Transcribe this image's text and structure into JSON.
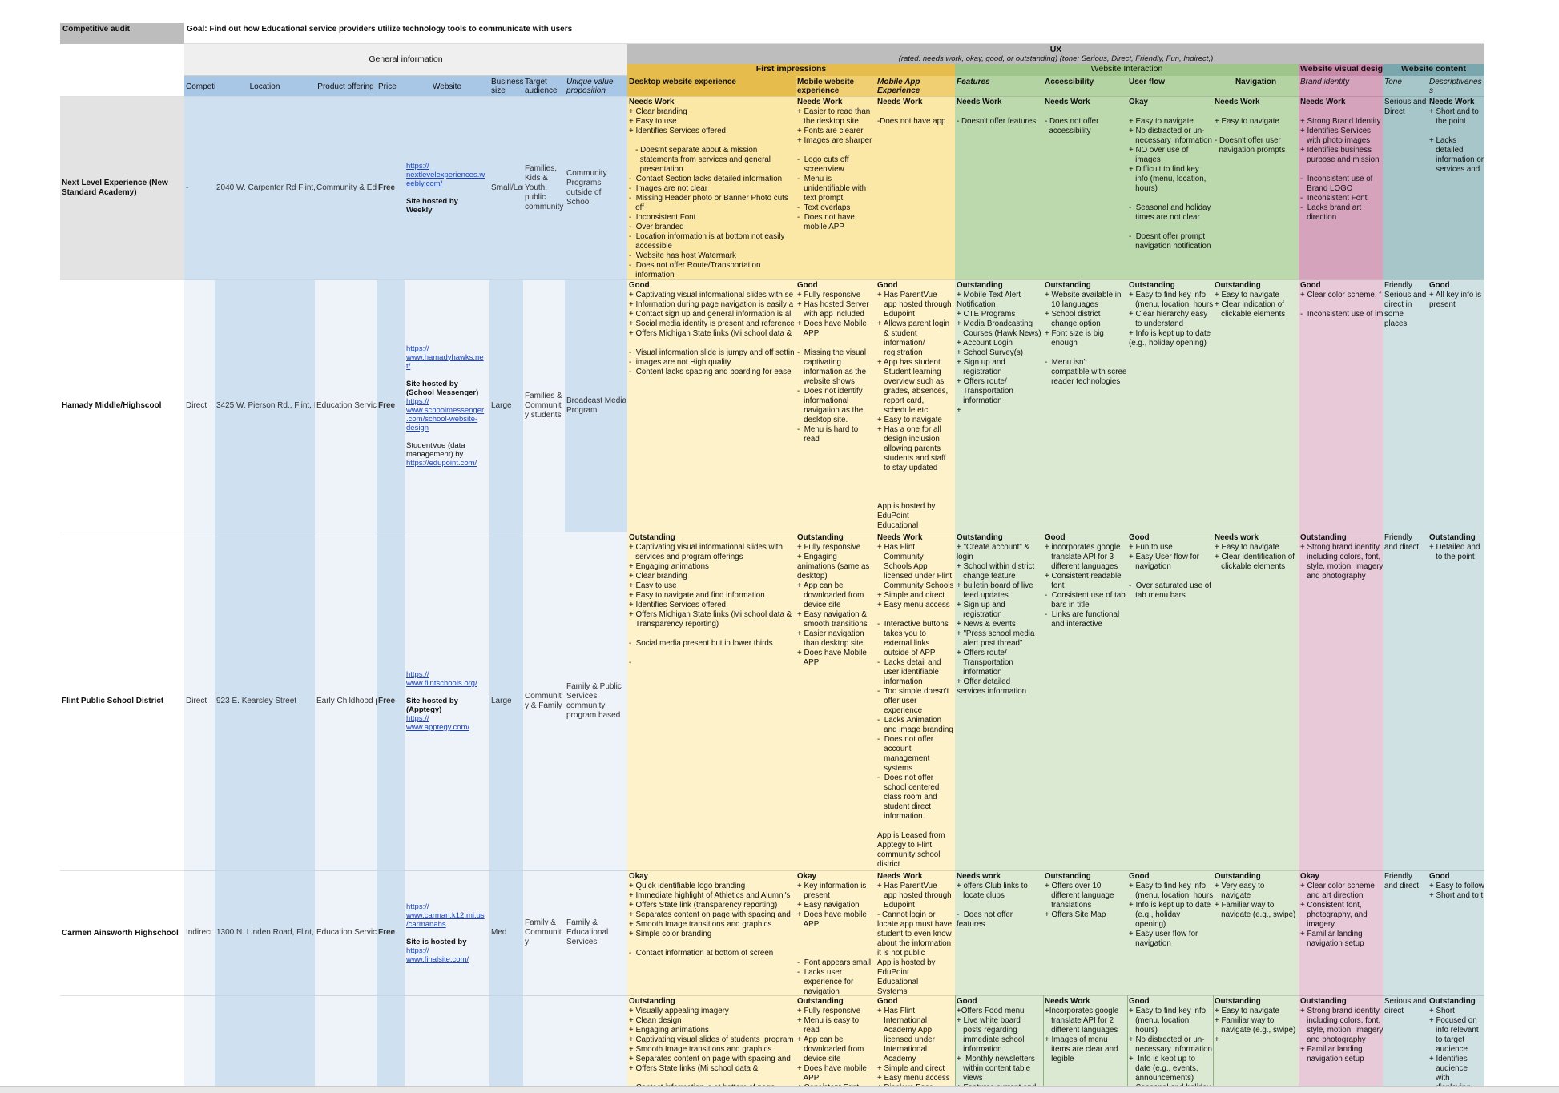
{
  "header": {
    "audit_label": "Competitive audit",
    "goal": "Goal: Find out how Educational service providers utilize technology tools to communicate with users",
    "general_information": "General information",
    "ux_title": "UX",
    "ux_subtitle": "(rated: needs work, okay, good, or outstanding) (tone: Serious, Direct, Friendly, Fun, Indirect,)",
    "first_impressions": "First impressions",
    "website_interaction": "Website Interaction",
    "website_visual_design": "Website visual design",
    "website_content": "Website content"
  },
  "columns": {
    "competitor": "Competi",
    "location": "Location",
    "product_offering": "Product offering",
    "price": "Price",
    "website": "Website",
    "business_size": "Business size",
    "target_audience": "Target audience",
    "uvp": "Unique value proposition",
    "desktop": "Desktop website experience",
    "mobile_web": "Mobile website experience",
    "mobile_app": "Mobile App Experience",
    "features": "Features",
    "accessibility": "Accessibility",
    "user_flow": "User flow",
    "navigation": "Navigation",
    "brand": "Brand identity",
    "tone": "Tone",
    "descriptiveness": "Descriptivenes s"
  },
  "rows": [
    {
      "name": "Next Level Experience (New Standard Academy)",
      "type": "-",
      "location": "2040 W. Carpenter Rd Flint,",
      "product": "Community & Edi",
      "price": "Free",
      "web_link": "https://\nnextlevelexperiences.w\neebly.com/",
      "web_note": "Site hosted by\nWeekly",
      "size": "Small/Lar",
      "audience": "Families,\nKids &\nYouth,\npublic\ncommunity",
      "uvp": "Community\nPrograms\noutside of\nSchool",
      "desktop_rating": "Needs Work",
      "desktop": "+ Clear branding\n+ Easy to use\n+ Identifies Services offered\n\n   - Does'nt separate about & mission\n     statements from services and general\n     presentation\n-  Contact Section lacks detailed information\n-  Images are not clear\n-  Missing Header photo or Banner Photo cuts\n   off\n-  Inconsistent Font\n-  Over branded\n-  Location information is at bottom not easily\n   accessible\n-  Website has host Watermark\n-  Does not offer Route/Transportation\n   information",
      "mobile_rating": "Needs Work",
      "mobile": "+ Easier to read than\n   the desktop site\n+ Fonts are clearer\n+ Images are sharper\n\n-  Logo cuts off\n   screenView\n-  Menu is\n   unidentifiable with\n   text prompt\n-  Text overlaps\n-  Does not have\n   mobile APP",
      "app_rating": "Needs Work",
      "app": "\n-Does not have app",
      "features_rating": "Needs Work",
      "features": "\n- Doesn't offer features",
      "access_rating": "Needs Work",
      "access": "\n- Does not offer\n  accessibility",
      "flow_rating": "Okay",
      "flow": "\n+ Easy to navigate\n+ No distracted or un-\n   necessary information\n+ NO over use of\n   images\n+ Difficult to find key\n   info (menu, location,\n   hours)\n\n-  Seasonal and holiday\n   times are not clear\n\n-  Doesnt offer prompt\n   navigation notification",
      "nav_rating": "Needs Work",
      "nav": "\n+ Easy to navigate\n\n- Doesn't offer user\n  navigation prompts",
      "brand_rating": "Needs Work",
      "brand": "\n+ Strong Brand Identity\n+ Identifies Services\n   with photo images\n+ Identifies business\n   purpose and mission\n\n-  Inconsistent use of\n   Brand LOGO\n-  Inconsistent Font\n-  Lacks brand art\n   direction",
      "tone": "Serious and\nDirect",
      "desc_rating": "Needs Work",
      "desc": "+ Short and to\n   the point\n\n+ Lacks\n   detailed\n   information on\n   services and"
    },
    {
      "name": "Hamady Middle/Highscool",
      "type": "Direct",
      "location": "3425 W. Pierson Rd., Flint, I",
      "product": "Education Servic",
      "price": "Free",
      "web_link": "https://\nwww.hamadyhawks.ne\nt/",
      "web_note": "Site hosted by\n(School Messenger)",
      "web_link2": "https://\nwww.schoolmessenger\n.com/school-website-\ndesign",
      "web_note2": "StudentVue (data\nmanagement) by",
      "web_link3": "https://edupoint.com/",
      "size": "Large",
      "audience": "Families &\nCommunit\ny students",
      "uvp": "Broadcast Media\nProgram",
      "desktop_rating": "Good",
      "desktop": "+ Captivating visual informational slides with se\n+ Information during page navigation is easily a\n+ Contact sign up and general information is all\n+ Social media identity is present and reference\n+ Offers Michigan State links (Mi school data &\n\n-  Visual information slide is jumpy and off settin\n-  images are not High quality\n-  Content lacks spacing and boarding for ease",
      "mobile_rating": "Good",
      "mobile": "+ Fully responsive\n+ Has hosted Server\n   with app included\n+ Does have Mobile\n   APP\n\n-  Missing the visual\n   captivating\n   information as the\n   website shows\n-  Does not identify\n   informational\n   navigation as the\n   desktop site.\n-  Menu is hard to\n   read",
      "app_rating": "Good",
      "app": "+ Has ParentVue\n   app hosted through\n   Edupoint\n+ Allows parent login\n   & student\n   information/\n   registration\n+ App has student\n   Student learning\n   overview such as\n   grades, absences,\n   report card,\n   schedule etc.\n+ Easy to navigate\n+ Has a one for all\n   design inclusion\n   allowing parents\n   students and staff\n   to stay updated\n\n\n\nApp is hosted by\nEduPoint\nEducational\nSystems",
      "features_rating": "Outstanding",
      "features": "+ Mobile Text Alert\nNotification\n+ CTE Programs\n+ Media Broadcasting\n   Courses (Hawk News)\n+ Account Login\n+ School Survey(s)\n+ Sign up and\n   registration\n+ Offers route/\n   Transportation\n   information\n+",
      "access_rating": "Outstanding",
      "access": "+ Website available in\n   10 languages\n+ School district\n   change option\n+ Font size is big\n   enough\n\n-  Menu isn't\n   compatible with screen\n   reader technologies",
      "flow_rating": "Outstanding",
      "flow": "+ Easy to find key info\n   (menu, location, hours)\n+ Clear hierarchy easy\n   to understand\n+ Info is kept up to date\n(e.g., holiday opening)",
      "nav_rating": "Outstanding",
      "nav": "+ Easy to navigate\n+ Clear indication of\n   clickable elements",
      "brand_rating": "Good",
      "brand": "+ Clear color scheme, f\n\n-  Inconsistent use of im",
      "tone": "Friendly\nSerious and\ndirect in\nsome\nplaces",
      "desc_rating": "Good",
      "desc": "+ All key info is\npresent"
    },
    {
      "name": "Flint Public School District",
      "type": "Direct",
      "location": "923 E. Kearsley Street",
      "product": "Early Childhood p",
      "price": "Free",
      "web_link": "https://\nwww.flintschools.org/",
      "web_note": "Site hosted by\n(Apptegy)",
      "web_link2": "https://\nwww.apptegy.com/",
      "size": "Large",
      "audience": "Communit\ny & Family",
      "uvp": "Family & Public\nServices\ncommunity\nprogram based",
      "desktop_rating": "Outstanding",
      "desktop": "+ Captivating visual informational slides with\n   services and program offerings\n+ Engaging animations\n+ Clear branding\n+ Easy to use\n+ Easy to navigate and find information\n+ Identifies Services offered\n+ Offers Michigan State links (Mi school data &\n   Transparency reporting)\n\n-  Social media present but in lower thirds\n\n-",
      "mobile_rating": "Outstanding",
      "mobile": "+ Fully responsive\n+ Engaging\nanimations (same as\ndesktop)\n+ App can be\n   downloaded from\n   device site\n+ Easy navigation &\n   smooth transitions\n+ Easier navigation\n   than desktop site\n+ Does have Mobile\n   APP",
      "app_rating": "Needs Work",
      "app": "+ Has Flint\n   Community\n   Schools App\n   licensed under Flint\n   Community Schools\n+ Simple and direct\n+ Easy menu access\n\n-  Interactive buttons\n   takes you to\n   external links\n   outside of APP\n-  Lacks detail and\n   user identifiable\n   information\n-  Too simple doesn't\n   offer user\n   experience\n-  Lacks Animation\n   and image branding\n-  Does not offer\n   account\n   management\n   systems\n-  Does not offer\n   school centered\n   class room and\n   student direct\n   information.\n\nApp is Leased from\nApptegy to Flint\ncommunity school\ndistrict",
      "features_rating": "Outstanding",
      "features": "+ \"Create account\" &\nlogin\n+ School within district\n   change feature\n+ bulletin board of live\n   feed updates\n+ Sign up and\n   registration\n+ News & events\n+ \"Press school media\n   alert post thread\"\n+ Offers route/\n   Transportation\n   information\n+ Offer detailed\nservices information",
      "access_rating": "Good",
      "access": "+ incorporates google\n   translate API for 3\n   different languages\n+ Consistent readable\n   font\n-  Consistent use of tab\n   bars in title\n-  Links are functional\n   and interactive",
      "flow_rating": "Good",
      "flow": "+ Fun to use\n+ Easy User flow for\n   navigation\n\n-  Over saturated use of\n   tab menu bars",
      "nav_rating": "Needs work",
      "nav": "+ Easy to navigate\n+ Clear identification of\n   clickable elements",
      "brand_rating": "Outstanding",
      "brand": "+ Strong brand identity,\n   including colors, font,\n   style, motion, imagery,\n   and photography",
      "tone": "Friendly\nand direct",
      "desc_rating": "Outstanding",
      "desc": "+ Detailed and\n   to the point"
    },
    {
      "name": "Carmen Ainsworth Highschool",
      "type": "Indirect",
      "location": "1300 N. Linden Road, Flint,",
      "product": "Education Servic",
      "price": "Free",
      "web_link": "https://\nwww.carman.k12.mi.us\n/carmanahs",
      "web_note": "Site is hosted by",
      "web_link2": "https://\nwww.finalsite.com/",
      "size": "Med",
      "audience": "Family &\nCommunit\ny",
      "uvp": "Family &\nEducational\nServices",
      "desktop_rating": "Okay",
      "desktop": "+ Quick identifiable logo branding\n+ Immediate highlight of Athletics and Alumni's\n+ Offers State link (transparency reporting)\n+ Separates content on page with spacing and\n+ Smooth Image transitions and graphics\n+ Simple color branding\n\n-  Contact information at bottom of screen",
      "mobile_rating": "Okay",
      "mobile": "+ Key information is\n   present\n+ Easy navigation\n+ Does have mobile\n   APP\n\n\n\n-  Font appears small\n-  Lacks user\n   experience for\n   navigation",
      "app_rating": "Needs Work",
      "app": "+ Has ParentVue\n   app hosted through\n   Edupoint\n- Cannot login or\nlocate app must have\nstudent to even know\nabout the information\nit is not public\nApp is hosted by\nEduPoint\nEducational\nSystems",
      "features_rating": "Needs work",
      "features": "+ offers Club links to\n   locate clubs\n\n-  Does not offer\nfeatures",
      "access_rating": "Outstanding",
      "access": "+ Offers over 10\n   different language\n   translations\n+ Offers Site Map",
      "flow_rating": "Good",
      "flow": "+ Easy to find key info\n   (menu, location, hours)\n+ Info is kept up to date\n   (e.g., holiday\n   opening)\n+ Easy user flow for\n   navigation",
      "nav_rating": "Outstanding",
      "nav": "+ Very easy to\n   navigate\n+ Familiar way to\n   navigate (e.g., swipe)",
      "brand_rating": "Okay",
      "brand": "+ Clear color scheme\n   and art direction\n+ Consistent font,\n   photography, and\n   imagery\n+ Familiar landing\n   navigation setup",
      "tone": "Friendly\nand direct",
      "desc_rating": "Good",
      "desc": "+ Easy to follow\n+ Short and to t"
    },
    {
      "name": "",
      "desktop_rating": "Outstanding",
      "desktop": "+ Visually appealing imagery\n+ Clean design\n+ Engaging animations\n+ Captivating visual slides of students  program\n+ Smooth Image transitions and graphics\n+ Separates content on page with spacing and\n+ Offers State links (Mi school data &\n\n-  Contact information is at bottom of page",
      "mobile_rating": "Outstanding",
      "mobile": "+ Fully responsive\n+ Menu is easy to\n   read\n+ App can be\n   downloaded from\n   device site\n+ Does have mobile\n   APP\n+ Consistent Font",
      "app_rating": "Good",
      "app": "+ Has Flint\n   International\n   Academy App\n   licensed under\n   International\n   Academy\n+ Simple and direct\n+ Easy menu access\n+ Displays Food",
      "features_rating": "Good",
      "features": "+Offers Food menu\n+ Live white board\n   posts regarding\n   immediate school\n   information\n+  Monthly newsletters\n   within content table\n   views\n+ Features current and",
      "access_rating": "Needs Work",
      "access": "+Incorporates google\n   translate API for 2\n   different languages\n+ Images of menu\n   items are clear and\n   legible",
      "flow_rating": "Good",
      "flow": "+ Easy to find key info\n   (menu, location,\n   hours)\n+ No distracted or un-\n   necessary information\n+  Info is kept up to\n   date (e.g., events,\n   announcements)\n-  Seasonal and holiday",
      "nav_rating": "Outstanding",
      "nav": "+ Easy to navigate\n+ Familiar way to\n   navigate (e.g., swipe)\n+",
      "brand_rating": "Outstanding",
      "brand": "+ Strong brand identity,\n   including colors, font,\n   style, motion, imagery,\n   and photography\n+ Familiar landing\n   navigation setup",
      "tone": "Serious and\ndirect",
      "desc_rating": "Outstanding",
      "desc": "+ Short\n+ Focused on\n   info relevant\n   to target\n   audience\n+ Identifies\n   audience\n   with\n   displaying"
    }
  ],
  "colors": {
    "general_bg": "#cfe0f1",
    "general_alt": "#eef3f9",
    "first_impr_bg": "#fdf2c9",
    "first_impr_head": "#e6bd4d",
    "interaction_bg": "#dbe9d3",
    "interaction_head": "#9fc58b",
    "visual_bg": "#e8c9d8",
    "visual_head": "#c689a8",
    "content_bg": "#d0e1e3",
    "content_head": "#7aa7ad",
    "ux_head": "#bdbdbd"
  }
}
